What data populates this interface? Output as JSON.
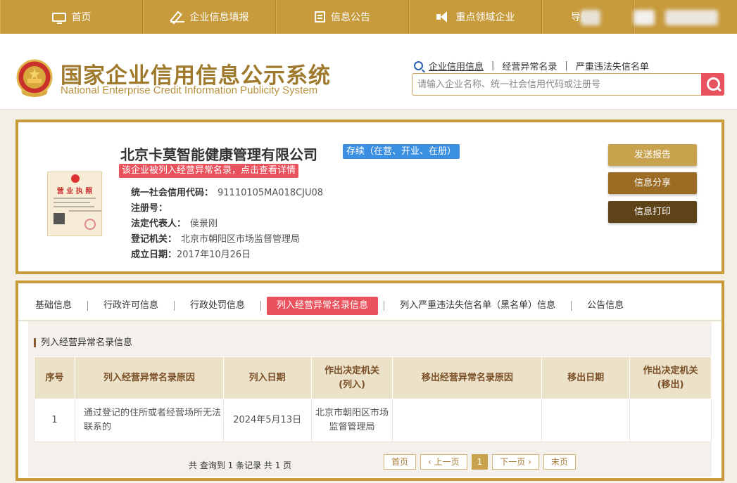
{
  "topnav": {
    "items": [
      {
        "label": "首页",
        "icon": "monitor-icon"
      },
      {
        "label": "企业信息填报",
        "icon": "pen-icon"
      },
      {
        "label": "信息公告",
        "icon": "document-icon"
      },
      {
        "label": "重点领域企业",
        "icon": "speaker-icon"
      },
      {
        "label": "导航",
        "icon": ""
      }
    ]
  },
  "header": {
    "title_cn": "国家企业信用信息公示系统",
    "title_en": "National Enterprise Credit Information Publicity System",
    "search_links": [
      "企业信用信息",
      "经营异常名录",
      "严重违法失信名单"
    ],
    "search_placeholder": "请输入企业名称、统一社会信用代码或注册号"
  },
  "company": {
    "name": "北京卡莫智能健康管理有限公司",
    "status": "存续（在营、开业、在册）",
    "abnormal_notice": "该企业被列入经营异常名录，点击查看详情",
    "license_label": "营 业 执 照",
    "fields": [
      {
        "label": "统一社会信用代码：",
        "value": "91110105MA018CJU08"
      },
      {
        "label": "注册号：",
        "value": ""
      },
      {
        "label": "法定代表人：",
        "value": "侯景刚"
      },
      {
        "label": "登记机关：",
        "value": "北京市朝阳区市场监督管理局"
      },
      {
        "label": "成立日期：",
        "value": "2017年10月26日"
      }
    ],
    "actions": {
      "send": "发送报告",
      "share": "信息分享",
      "print": "信息打印"
    }
  },
  "tabs": [
    "基础信息",
    "行政许可信息",
    "行政处罚信息",
    "列入经营异常名录信息",
    "列入严重违法失信名单（黑名单）信息",
    "公告信息"
  ],
  "active_tab": 3,
  "section": {
    "title": "列入经营异常名录信息",
    "columns": [
      "序号",
      "列入经营异常名录原因",
      "列入日期",
      "作出决定机关\n(列入)",
      "移出经营异常名录原因",
      "移出日期",
      "作出决定机关\n(移出)"
    ],
    "rows": [
      [
        "1",
        "通过登记的住所或者经营场所无法联系的",
        "2024年5月13日",
        "北京市朝阳区市场监督管理局",
        "",
        "",
        ""
      ]
    ],
    "count_text": "共 查询到 1 条记录 共 1 页",
    "pager": {
      "first": "首页",
      "prev": "‹ 上一页",
      "current": "1",
      "next": "下一页 ›",
      "last": "末页"
    }
  },
  "colors": {
    "gold": "#c79a3c",
    "red": "#e9525d",
    "blue": "#3b8fe0",
    "btn_send": "#c9a24e",
    "btn_share": "#9c6b24",
    "btn_print": "#5e4318"
  }
}
